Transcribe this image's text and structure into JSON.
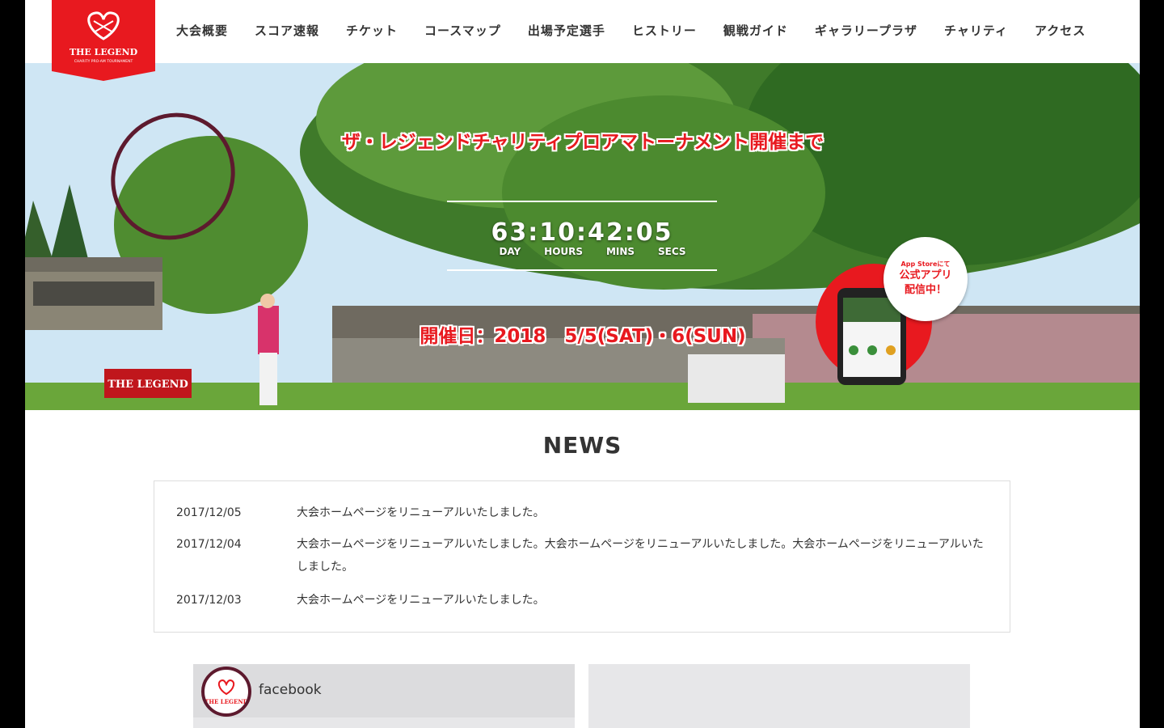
{
  "brand": {
    "logo_text": "THE LEGEND",
    "logo_subtext": "CHARITY PRO-AM TOURNAMENT",
    "accent_color": "#e8191f",
    "annotation_color": "#5d1a2e"
  },
  "nav": {
    "items": [
      {
        "label": "大会概要"
      },
      {
        "label": "スコア速報"
      },
      {
        "label": "チケット"
      },
      {
        "label": "コースマップ"
      },
      {
        "label": "出場予定選手"
      },
      {
        "label": "ヒストリー"
      },
      {
        "label": "観戦ガイド"
      },
      {
        "label": "ギャラリープラザ"
      },
      {
        "label": "チャリティ"
      },
      {
        "label": "アクセス"
      }
    ]
  },
  "hero": {
    "headline": "ザ・レジェンドチャリティプロアマトーナメント開催まで",
    "countdown": "63:10:42:05",
    "countdown_labels": [
      "DAY",
      "HOURS",
      "MINS",
      "SECS"
    ],
    "event_date": "開催日：2018　5/5(SAT)・6(SUN)",
    "sign_text": "THE LEGEND",
    "app_badge": {
      "small": "App Storeにて",
      "line1": "公式アプリ",
      "line2": "配信中！"
    }
  },
  "news": {
    "title": "NEWS",
    "items": [
      {
        "date": "2017/12/05",
        "text": "大会ホームページをリニューアルいたしました。"
      },
      {
        "date": "2017/12/04",
        "text": "大会ホームページをリニューアルいたしました。大会ホームページをリニューアルいたしました。大会ホームページをリニューアルいたしました。"
      },
      {
        "date": "2017/12/03",
        "text": "大会ホームページをリニューアルいたしました。"
      }
    ]
  },
  "social": {
    "facebook_label": "facebook"
  }
}
